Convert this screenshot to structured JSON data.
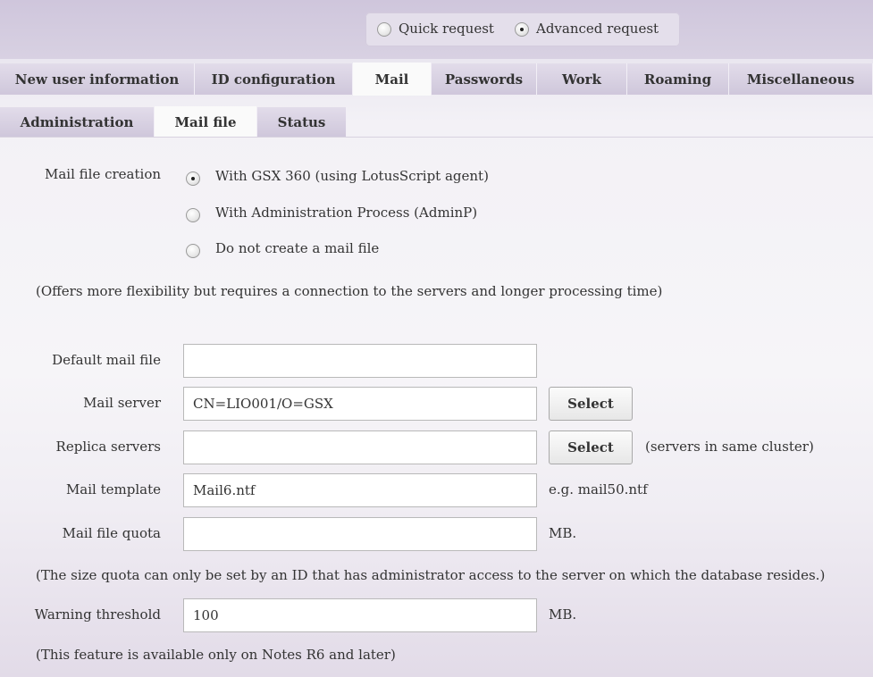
{
  "request_mode": {
    "options": [
      {
        "label": "Quick request",
        "selected": false
      },
      {
        "label": "Advanced request",
        "selected": true
      }
    ]
  },
  "main_tabs": [
    {
      "label": "New user information",
      "active": false
    },
    {
      "label": "ID configuration",
      "active": false
    },
    {
      "label": "Mail",
      "active": true
    },
    {
      "label": "Passwords",
      "active": false
    },
    {
      "label": "Work",
      "active": false
    },
    {
      "label": "Roaming",
      "active": false
    },
    {
      "label": "Miscellaneous",
      "active": false
    }
  ],
  "sub_tabs": [
    {
      "label": "Administration",
      "active": false
    },
    {
      "label": "Mail file",
      "active": true
    },
    {
      "label": "Status",
      "active": false
    }
  ],
  "mail_file_creation": {
    "label": "Mail file creation",
    "options": [
      {
        "label": "With GSX 360 (using LotusScript agent)",
        "selected": true
      },
      {
        "label": "With Administration Process (AdminP)",
        "selected": false
      },
      {
        "label": "Do not create a mail file",
        "selected": false
      }
    ],
    "note": "(Offers more flexibility but requires a connection to the servers and longer processing time)"
  },
  "fields": {
    "default_mail_file": {
      "label": "Default mail file",
      "value": ""
    },
    "mail_server": {
      "label": "Mail server",
      "value": "CN=LIO001/O=GSX",
      "button": "Select"
    },
    "replica_servers": {
      "label": "Replica servers",
      "value": "",
      "button": "Select",
      "hint": "(servers in same cluster)"
    },
    "mail_template": {
      "label": "Mail template",
      "value": "Mail6.ntf",
      "hint": "e.g. mail50.ntf"
    },
    "mail_file_quota": {
      "label": "Mail file quota",
      "value": "",
      "unit": "MB."
    },
    "quota_note": "(The size quota can only be set by an ID that has administrator access to the server on which the database resides.)",
    "warning_threshold": {
      "label": "Warning threshold",
      "value": "100",
      "unit": "MB."
    },
    "threshold_note": "(This feature is available only on Notes R6 and later)"
  }
}
